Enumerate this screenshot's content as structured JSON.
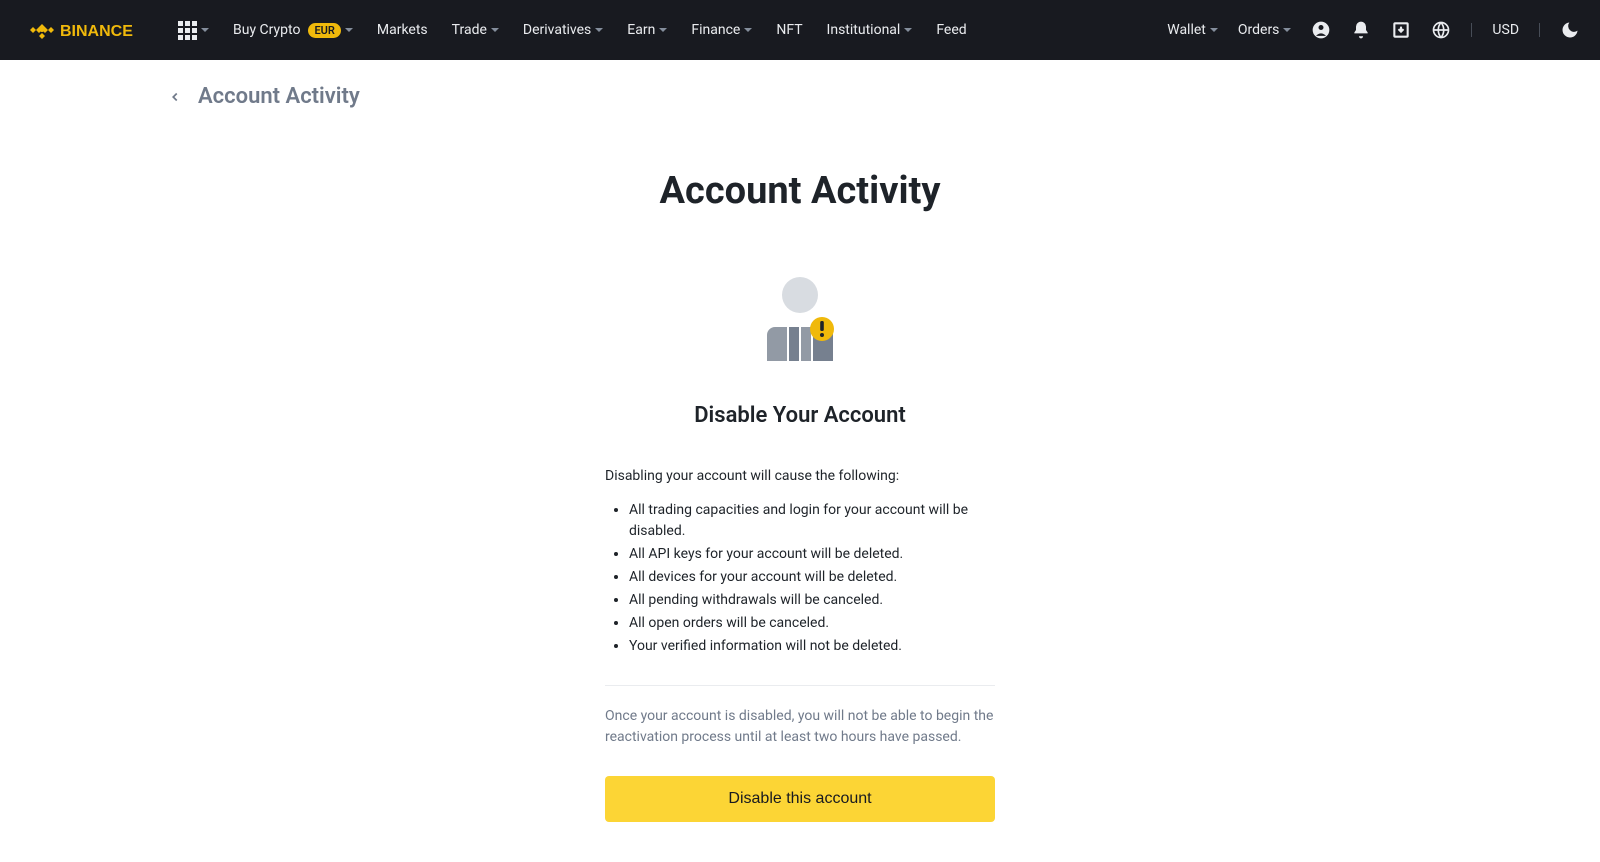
{
  "brand": "BINANCE",
  "nav": {
    "buy_crypto": "Buy Crypto",
    "buy_crypto_badge": "EUR",
    "markets": "Markets",
    "trade": "Trade",
    "derivatives": "Derivatives",
    "earn": "Earn",
    "finance": "Finance",
    "nft": "NFT",
    "institutional": "Institutional",
    "feed": "Feed",
    "wallet": "Wallet",
    "orders": "Orders",
    "currency": "USD"
  },
  "breadcrumb": {
    "title": "Account Activity"
  },
  "page": {
    "title": "Account Activity",
    "section_title": "Disable Your Account",
    "intro": "Disabling your account will cause the following:",
    "bullets": [
      "All trading capacities and login for your account will be disabled.",
      "All API keys for your account will be deleted.",
      "All devices for your account will be deleted.",
      "All pending withdrawals will be canceled.",
      "All open orders will be canceled.",
      "Your verified information will not be deleted."
    ],
    "note": "Once your account is disabled, you will not be able to begin the reactivation process until at least two hours have passed.",
    "button": "Disable this account"
  }
}
